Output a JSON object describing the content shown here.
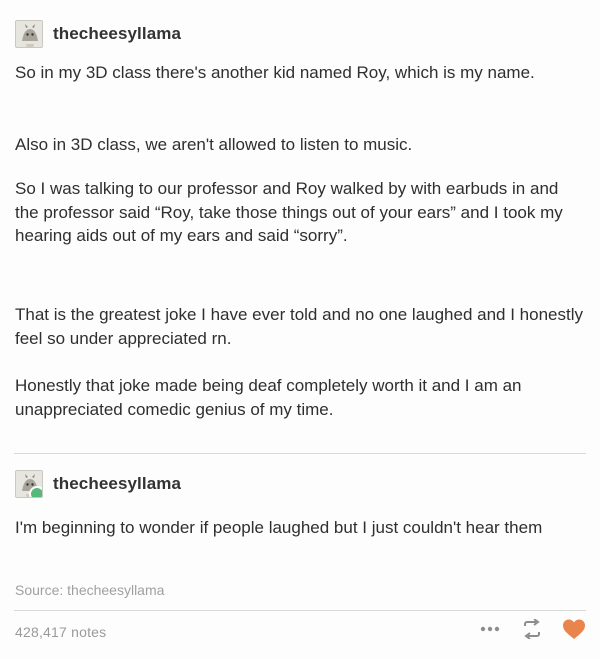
{
  "post1": {
    "username": "thecheesyllama",
    "paragraphs": [
      "So in my 3D class there's another kid named Roy, which is my name.",
      "Also in 3D class, we aren't allowed to listen to music.",
      "So I was talking to our professor and Roy walked by with earbuds in and the professor said “Roy, take those things out of your ears” and I took my hearing aids out of my ears and said “sorry”.",
      "That is the greatest joke I have ever told and no one laughed and I honestly feel so under appreciated rn.",
      "Honestly that joke made being deaf completely worth it and I am an unappreciated comedic genius of my time."
    ]
  },
  "post2": {
    "username": "thecheesyllama",
    "paragraphs": [
      "I'm beginning to wonder if people laughed but I just couldn't hear them"
    ]
  },
  "footer": {
    "source": "Source: thecheesyllama",
    "notes": "428,417 notes",
    "icons": [
      "more-icon",
      "reblog-icon",
      "heart-icon"
    ],
    "accent": "#e8844c"
  }
}
